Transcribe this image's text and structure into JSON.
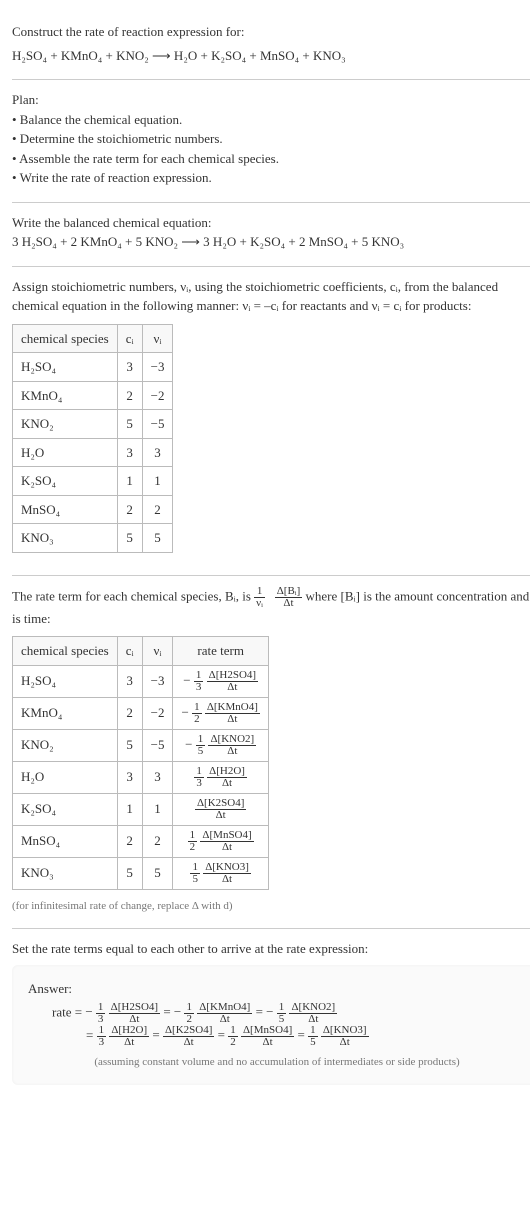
{
  "intro": {
    "title": "Construct the rate of reaction expression for:",
    "equation": "H₂SO₄ + KMnO₄ + KNO₂  ⟶  H₂O + K₂SO₄ + MnSO₄ + KNO₃"
  },
  "plan": {
    "title": "Plan:",
    "items": [
      "Balance the chemical equation.",
      "Determine the stoichiometric numbers.",
      "Assemble the rate term for each chemical species.",
      "Write the rate of reaction expression."
    ]
  },
  "balanced": {
    "title": "Write the balanced chemical equation:",
    "equation": "3 H₂SO₄ + 2 KMnO₄ + 5 KNO₂  ⟶  3 H₂O + K₂SO₄ + 2 MnSO₄ + 5 KNO₃"
  },
  "stoich": {
    "intro": "Assign stoichiometric numbers, νᵢ, using the stoichiometric coefficients, cᵢ, from the balanced chemical equation in the following manner: νᵢ = –cᵢ for reactants and νᵢ = cᵢ for products:",
    "headers": [
      "chemical species",
      "cᵢ",
      "νᵢ"
    ],
    "rows": [
      {
        "species": "H₂SO₄",
        "c": "3",
        "v": "−3"
      },
      {
        "species": "KMnO₄",
        "c": "2",
        "v": "−2"
      },
      {
        "species": "KNO₂",
        "c": "5",
        "v": "−5"
      },
      {
        "species": "H₂O",
        "c": "3",
        "v": "3"
      },
      {
        "species": "K₂SO₄",
        "c": "1",
        "v": "1"
      },
      {
        "species": "MnSO₄",
        "c": "2",
        "v": "2"
      },
      {
        "species": "KNO₃",
        "c": "5",
        "v": "5"
      }
    ]
  },
  "rateterm": {
    "intro_a": "The rate term for each chemical species, Bᵢ, is ",
    "intro_b": " where [Bᵢ] is the amount concentration and t is time:",
    "frac_outer_num": "1",
    "frac_outer_den": "νᵢ",
    "frac_inner_num": "Δ[Bᵢ]",
    "frac_inner_den": "Δt",
    "headers": [
      "chemical species",
      "cᵢ",
      "νᵢ",
      "rate term"
    ],
    "rows": [
      {
        "species": "H₂SO₄",
        "c": "3",
        "v": "−3",
        "coef_num": "1",
        "coef_den": "3",
        "sign": "−",
        "d_num": "Δ[H2SO4]",
        "d_den": "Δt"
      },
      {
        "species": "KMnO₄",
        "c": "2",
        "v": "−2",
        "coef_num": "1",
        "coef_den": "2",
        "sign": "−",
        "d_num": "Δ[KMnO4]",
        "d_den": "Δt"
      },
      {
        "species": "KNO₂",
        "c": "5",
        "v": "−5",
        "coef_num": "1",
        "coef_den": "5",
        "sign": "−",
        "d_num": "Δ[KNO2]",
        "d_den": "Δt"
      },
      {
        "species": "H₂O",
        "c": "3",
        "v": "3",
        "coef_num": "1",
        "coef_den": "3",
        "sign": "",
        "d_num": "Δ[H2O]",
        "d_den": "Δt"
      },
      {
        "species": "K₂SO₄",
        "c": "1",
        "v": "1",
        "coef_num": "",
        "coef_den": "",
        "sign": "",
        "d_num": "Δ[K2SO4]",
        "d_den": "Δt"
      },
      {
        "species": "MnSO₄",
        "c": "2",
        "v": "2",
        "coef_num": "1",
        "coef_den": "2",
        "sign": "",
        "d_num": "Δ[MnSO4]",
        "d_den": "Δt"
      },
      {
        "species": "KNO₃",
        "c": "5",
        "v": "5",
        "coef_num": "1",
        "coef_den": "5",
        "sign": "",
        "d_num": "Δ[KNO3]",
        "d_den": "Δt"
      }
    ],
    "note": "(for infinitesimal rate of change, replace Δ with d)"
  },
  "final": {
    "title": "Set the rate terms equal to each other to arrive at the rate expression:",
    "answer_label": "Answer:",
    "rate_label": "rate =",
    "terms_line1": [
      {
        "sign": "−",
        "coef_num": "1",
        "coef_den": "3",
        "d_num": "Δ[H2SO4]",
        "d_den": "Δt"
      },
      {
        "sign": "−",
        "coef_num": "1",
        "coef_den": "2",
        "d_num": "Δ[KMnO4]",
        "d_den": "Δt"
      },
      {
        "sign": "−",
        "coef_num": "1",
        "coef_den": "5",
        "d_num": "Δ[KNO2]",
        "d_den": "Δt"
      }
    ],
    "terms_line2": [
      {
        "sign": "",
        "coef_num": "1",
        "coef_den": "3",
        "d_num": "Δ[H2O]",
        "d_den": "Δt"
      },
      {
        "sign": "",
        "coef_num": "",
        "coef_den": "",
        "d_num": "Δ[K2SO4]",
        "d_den": "Δt"
      },
      {
        "sign": "",
        "coef_num": "1",
        "coef_den": "2",
        "d_num": "Δ[MnSO4]",
        "d_den": "Δt"
      },
      {
        "sign": "",
        "coef_num": "1",
        "coef_den": "5",
        "d_num": "Δ[KNO3]",
        "d_den": "Δt"
      }
    ],
    "assumption": "(assuming constant volume and no accumulation of intermediates or side products)"
  }
}
